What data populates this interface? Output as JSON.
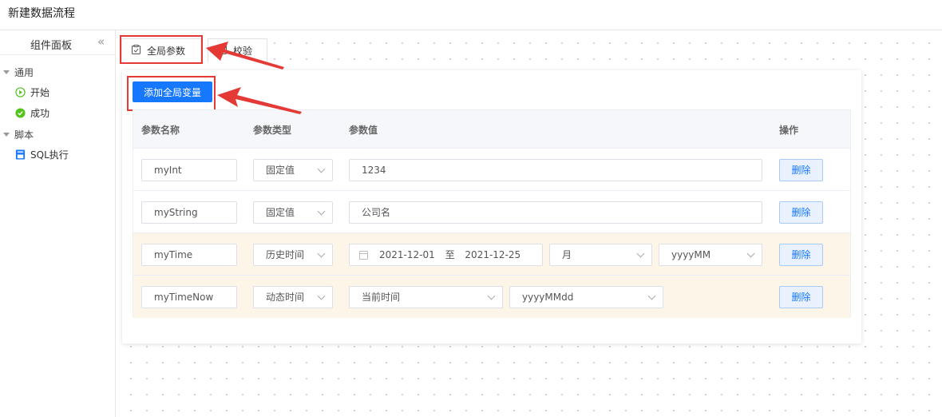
{
  "app": {
    "title": "新建数据流程"
  },
  "sidebar": {
    "title": "组件面板",
    "collapse_glyph": "«",
    "groups": [
      {
        "label": "通用",
        "items": [
          {
            "label": "开始",
            "icon": "play-circle-icon"
          },
          {
            "label": "成功",
            "icon": "check-circle-icon"
          }
        ]
      },
      {
        "label": "脚本",
        "items": [
          {
            "label": "SQL执行",
            "icon": "sql-file-icon"
          }
        ]
      }
    ]
  },
  "tabs": [
    {
      "label": "全局参数",
      "icon": "clipboard-icon",
      "active": true
    },
    {
      "label": "校验",
      "icon": "checklist-icon",
      "active": false
    }
  ],
  "add_button_label": "添加全局变量",
  "table": {
    "headers": [
      "参数名称",
      "参数类型",
      "参数值",
      "操作"
    ],
    "rows": [
      {
        "name": "myInt",
        "type": "固定值",
        "value": "1234",
        "action": "删除"
      },
      {
        "name": "myString",
        "type": "固定值",
        "value": "公司名",
        "action": "删除"
      },
      {
        "name": "myTime",
        "type": "历史时间",
        "start": "2021-12-01",
        "sep": "至",
        "end": "2021-12-25",
        "unit": "月",
        "format": "yyyyMM",
        "action": "删除"
      },
      {
        "name": "myTimeNow",
        "type": "动态时间",
        "value": "当前时间",
        "format": "yyyyMMdd",
        "action": "删除"
      }
    ]
  },
  "colors": {
    "primary": "#1677ff",
    "annotation": "#e53935",
    "highlight_row": "#fdf6e8"
  }
}
